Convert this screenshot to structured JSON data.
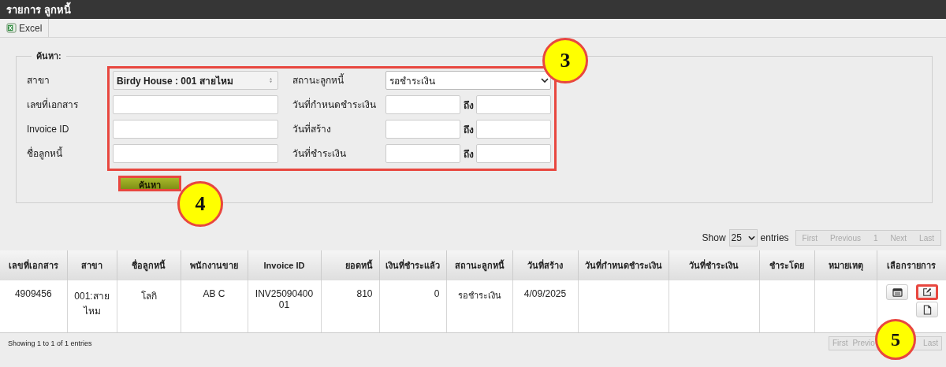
{
  "window": {
    "title": "รายการ ลูกหนี้"
  },
  "toolbar": {
    "buttons": [
      {
        "label": "Excel",
        "kind": "excel"
      }
    ]
  },
  "search": {
    "legend": "ค้นหา:",
    "left_fields": [
      {
        "label": "สาขา",
        "kind": "select",
        "value": "Birdy House : 001 สายไหม"
      },
      {
        "label": "เลขที่เอกสาร",
        "kind": "text"
      },
      {
        "label": "Invoice ID",
        "kind": "text"
      },
      {
        "label": "ชื่อลูกหนี้",
        "kind": "text"
      }
    ],
    "right_fields": [
      {
        "label": "สถานะลูกหนี้",
        "kind": "dropdown",
        "value": "รอชำระเงิน"
      },
      {
        "label": "วันที่กำหนดชำระเงิน",
        "kind": "range",
        "to_label": "ถึง"
      },
      {
        "label": "วันที่สร้าง",
        "kind": "range",
        "to_label": "ถึง"
      },
      {
        "label": "วันที่ชำระเงิน",
        "kind": "range",
        "to_label": "ถึง"
      }
    ],
    "highlighted": true,
    "button": {
      "label": "ค้นหา",
      "highlighted": true
    }
  },
  "length_menu": {
    "prefix": "Show",
    "value": "25",
    "suffix": "entries"
  },
  "pagination_top": [
    {
      "label": "First",
      "disabled": true
    },
    {
      "label": "Previous",
      "disabled": true
    },
    {
      "label": "1",
      "disabled": true
    },
    {
      "label": "Next",
      "disabled": true
    },
    {
      "label": "Last",
      "disabled": true
    }
  ],
  "table": {
    "columns": [
      "เลขที่เอกสาร",
      "สาขา",
      "ชื่อลูกหนี้",
      "พนักงานขาย",
      "Invoice ID",
      "ยอดหนี้",
      "เงินที่ชำระแล้ว",
      "สถานะลูกหนี้",
      "วันที่สร้าง",
      "วันที่กำหนดชำระเงิน",
      "วันที่ชำระเงิน",
      "ชำระโดย",
      "หมายเหตุ",
      "เลือกรายการ"
    ],
    "rows": [
      {
        "cells": [
          "4909456",
          "001:สายไหม",
          "โลกิ",
          "AB C",
          "INV2509040001",
          "810",
          "0",
          "รอชำระเงิน",
          "4/09/2025"
        ],
        "actions": [
          {
            "kind": "view",
            "highlighted": false
          },
          {
            "kind": "edit",
            "highlighted": true
          },
          {
            "kind": "document",
            "highlighted": false
          }
        ]
      }
    ]
  },
  "status_bar": {
    "info": "Showing 1 to 1 of 1 entries",
    "pagination": [
      {
        "label": "First",
        "disabled": true
      },
      {
        "label": "Previo",
        "disabled": true
      },
      {
        "label": "Last",
        "disabled": true
      }
    ]
  },
  "callouts": [
    {
      "label": "3"
    },
    {
      "label": "4"
    },
    {
      "label": "5"
    }
  ]
}
